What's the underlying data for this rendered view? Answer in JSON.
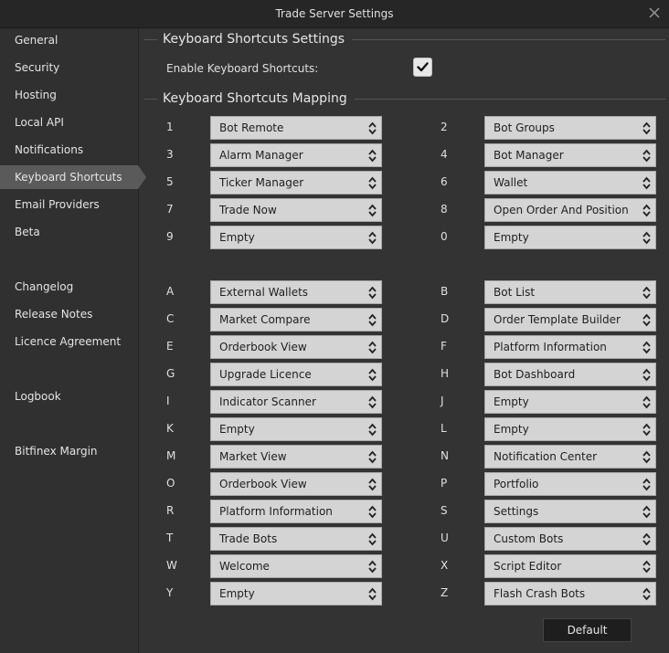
{
  "window": {
    "title": "Trade Server Settings"
  },
  "sidebar": {
    "items": [
      {
        "label": "General",
        "active": false
      },
      {
        "label": "Security",
        "active": false
      },
      {
        "label": "Hosting",
        "active": false
      },
      {
        "label": "Local API",
        "active": false
      },
      {
        "label": "Notifications",
        "active": false
      },
      {
        "label": "Keyboard Shortcuts",
        "active": true
      },
      {
        "label": "Email Providers",
        "active": false
      },
      {
        "label": "Beta",
        "active": false
      },
      {
        "label": "Changelog",
        "active": false
      },
      {
        "label": "Release Notes",
        "active": false
      },
      {
        "label": "Licence Agreement",
        "active": false
      },
      {
        "label": "Logbook",
        "active": false
      },
      {
        "label": "Bitfinex Margin",
        "active": false
      }
    ]
  },
  "settings": {
    "section_title": "Keyboard Shortcuts Settings",
    "enable_label": "Enable Keyboard Shortcuts:",
    "enabled": true
  },
  "mapping": {
    "section_title": "Keyboard Shortcuts Mapping",
    "number_rows": [
      [
        {
          "key": "1",
          "value": "Bot Remote"
        },
        {
          "key": "2",
          "value": "Bot Groups"
        }
      ],
      [
        {
          "key": "3",
          "value": "Alarm Manager"
        },
        {
          "key": "4",
          "value": "Bot Manager"
        }
      ],
      [
        {
          "key": "5",
          "value": "Ticker Manager"
        },
        {
          "key": "6",
          "value": "Wallet"
        }
      ],
      [
        {
          "key": "7",
          "value": "Trade Now"
        },
        {
          "key": "8",
          "value": "Open Order And Position"
        }
      ],
      [
        {
          "key": "9",
          "value": "Empty"
        },
        {
          "key": "0",
          "value": "Empty"
        }
      ]
    ],
    "letter_rows": [
      [
        {
          "key": "A",
          "value": "External Wallets"
        },
        {
          "key": "B",
          "value": "Bot List"
        }
      ],
      [
        {
          "key": "C",
          "value": "Market Compare"
        },
        {
          "key": "D",
          "value": "Order Template Builder"
        }
      ],
      [
        {
          "key": "E",
          "value": "Orderbook View"
        },
        {
          "key": "F",
          "value": "Platform Information"
        }
      ],
      [
        {
          "key": "G",
          "value": "Upgrade Licence"
        },
        {
          "key": "H",
          "value": "Bot Dashboard"
        }
      ],
      [
        {
          "key": "I",
          "value": "Indicator Scanner"
        },
        {
          "key": "J",
          "value": "Empty"
        }
      ],
      [
        {
          "key": "K",
          "value": "Empty"
        },
        {
          "key": "L",
          "value": "Empty"
        }
      ],
      [
        {
          "key": "M",
          "value": "Market View"
        },
        {
          "key": "N",
          "value": "Notification Center"
        }
      ],
      [
        {
          "key": "O",
          "value": "Orderbook View"
        },
        {
          "key": "P",
          "value": "Portfolio"
        }
      ],
      [
        {
          "key": "R",
          "value": "Platform Information"
        },
        {
          "key": "S",
          "value": "Settings"
        }
      ],
      [
        {
          "key": "T",
          "value": "Trade Bots"
        },
        {
          "key": "U",
          "value": "Custom Bots"
        }
      ],
      [
        {
          "key": "W",
          "value": "Welcome"
        },
        {
          "key": "X",
          "value": "Script Editor"
        }
      ],
      [
        {
          "key": "Y",
          "value": "Empty"
        },
        {
          "key": "Z",
          "value": "Flash Crash Bots"
        }
      ]
    ]
  },
  "footer": {
    "default_label": "Default"
  }
}
